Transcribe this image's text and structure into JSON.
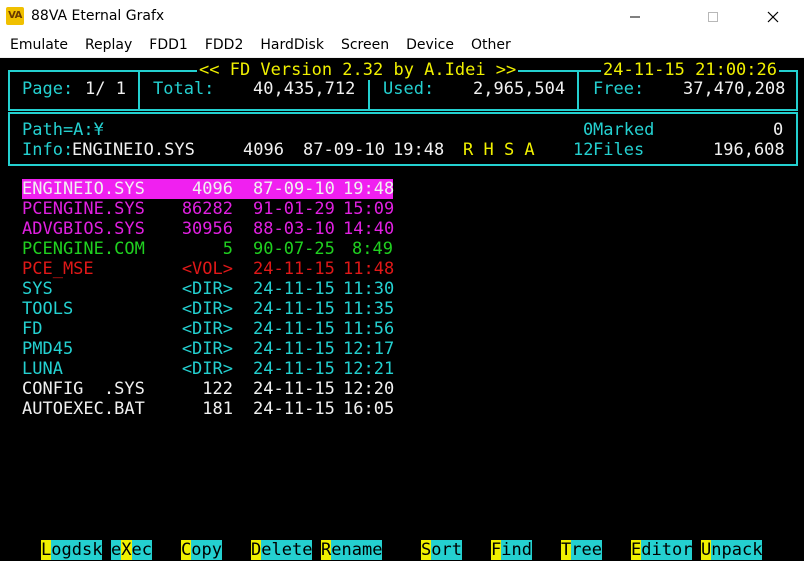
{
  "window": {
    "app_icon_text": "VA",
    "title": "88VA Eternal Grafx",
    "controls": {
      "minimize": "—",
      "maximize": "☐",
      "close": "✕"
    }
  },
  "menubar": [
    "Emulate",
    "Replay",
    "FDD1",
    "FDD2",
    "HardDisk",
    "Screen",
    "Device",
    "Other"
  ],
  "header": {
    "title": "<< FD Version 2.32 by A.Idei >>",
    "datetime": "24-11-15 21:00:26",
    "page_label": "Page:",
    "page_value": "1/ 1",
    "total_label": "Total:",
    "total_value": "40,435,712",
    "used_label": "Used:",
    "used_value": "2,965,504",
    "free_label": "Free:",
    "free_value": "37,470,208"
  },
  "info": {
    "path": "Path=A:¥",
    "marked_count": "0",
    "marked_label": "Marked",
    "marked_size": "0",
    "info_label": "Info:",
    "info_name": "ENGINEIO.SYS",
    "info_size": "4096",
    "info_date": "87-09-10",
    "info_time": "19:48",
    "attrs": "R H S A",
    "files_count": "12",
    "files_label": "Files",
    "files_size": "196,608"
  },
  "files": [
    {
      "name": "ENGINEIO.SYS",
      "size": "4096",
      "date": "87-09-10",
      "time": "19:48",
      "color": "#f0f0f0",
      "bg": "#f020f0"
    },
    {
      "name": "PCENGINE.SYS",
      "size": "86282",
      "date": "91-01-29",
      "time": "15:09",
      "color": "#e020e0"
    },
    {
      "name": "ADVGBIOS.SYS",
      "size": "30956",
      "date": "88-03-10",
      "time": "14:40",
      "color": "#e020e0"
    },
    {
      "name": "PCENGINE.COM",
      "size": "5",
      "date": "90-07-25",
      "time": "8:49",
      "color": "#20d020"
    },
    {
      "name": "PCE_MSE",
      "size": "<VOL>",
      "date": "24-11-15",
      "time": "11:48",
      "color": "#e01818"
    },
    {
      "name": "SYS",
      "size": "<DIR>",
      "date": "24-11-15",
      "time": "11:30",
      "color": "#24d0d0"
    },
    {
      "name": "TOOLS",
      "size": "<DIR>",
      "date": "24-11-15",
      "time": "11:35",
      "color": "#24d0d0"
    },
    {
      "name": "FD",
      "size": "<DIR>",
      "date": "24-11-15",
      "time": "11:56",
      "color": "#24d0d0"
    },
    {
      "name": "PMD45",
      "size": "<DIR>",
      "date": "24-11-15",
      "time": "12:17",
      "color": "#24d0d0"
    },
    {
      "name": "LUNA",
      "size": "<DIR>",
      "date": "24-11-15",
      "time": "12:21",
      "color": "#24d0d0"
    },
    {
      "name": "CONFIG  .SYS",
      "size": "122",
      "date": "24-11-15",
      "time": "12:20",
      "color": "#f0f0f0"
    },
    {
      "name": "AUTOEXEC.BAT",
      "size": "181",
      "date": "24-11-15",
      "time": "16:05",
      "color": "#f0f0f0"
    }
  ],
  "function_keys": [
    {
      "hotkey": "L",
      "rest": "ogdsk"
    },
    {
      "hotkey": "",
      "pre": "e",
      "key": "X",
      "post": "ec"
    },
    {
      "hotkey": "C",
      "rest": "opy"
    },
    {
      "hotkey": "D",
      "rest": "elete"
    },
    {
      "hotkey": "R",
      "rest": "ename"
    },
    {
      "hotkey": "S",
      "rest": "ort"
    },
    {
      "hotkey": "F",
      "rest": "ind"
    },
    {
      "hotkey": "T",
      "rest": "ree"
    },
    {
      "hotkey": "E",
      "rest": "ditor"
    },
    {
      "hotkey": "U",
      "rest": "npack"
    }
  ]
}
